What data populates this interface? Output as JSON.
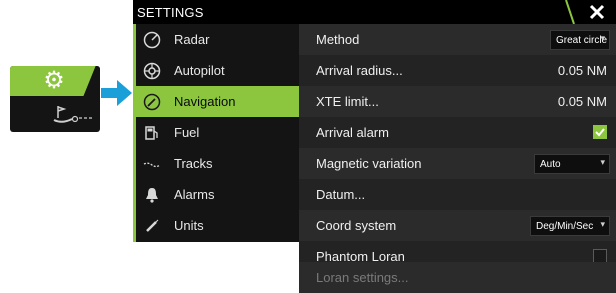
{
  "colors": {
    "accent": "#8cc63f",
    "arrow": "#1a9fd8",
    "background": "#1c1c1c"
  },
  "shortcut_tile": {
    "icon": "gear-icon",
    "badge_icon": "ship-icon"
  },
  "dialog": {
    "title": "SETTINGS",
    "close_icon": "close-icon"
  },
  "sidebar": {
    "items": [
      {
        "label": "Radar",
        "icon": "radar-icon",
        "active": false
      },
      {
        "label": "Autopilot",
        "icon": "autopilot-icon",
        "active": false
      },
      {
        "label": "Navigation",
        "icon": "navigation-icon",
        "active": true
      },
      {
        "label": "Fuel",
        "icon": "fuel-icon",
        "active": false
      },
      {
        "label": "Tracks",
        "icon": "tracks-icon",
        "active": false
      },
      {
        "label": "Alarms",
        "icon": "alarms-icon",
        "active": false
      },
      {
        "label": "Units",
        "icon": "units-icon",
        "active": false
      }
    ]
  },
  "settings": {
    "method": {
      "label": "Method",
      "value": "Great circle"
    },
    "arrival_radius": {
      "label": "Arrival radius...",
      "value": "0.05 NM"
    },
    "xte_limit": {
      "label": "XTE limit...",
      "value": "0.05 NM"
    },
    "arrival_alarm": {
      "label": "Arrival alarm",
      "checked": true
    },
    "magnetic_variation": {
      "label": "Magnetic variation",
      "value": "Auto"
    },
    "datum": {
      "label": "Datum..."
    },
    "coord_system": {
      "label": "Coord system",
      "value": "Deg/Min/Sec"
    },
    "phantom_loran": {
      "label": "Phantom Loran",
      "checked": false
    },
    "loran_settings": {
      "label": "Loran settings...",
      "enabled": false
    }
  }
}
